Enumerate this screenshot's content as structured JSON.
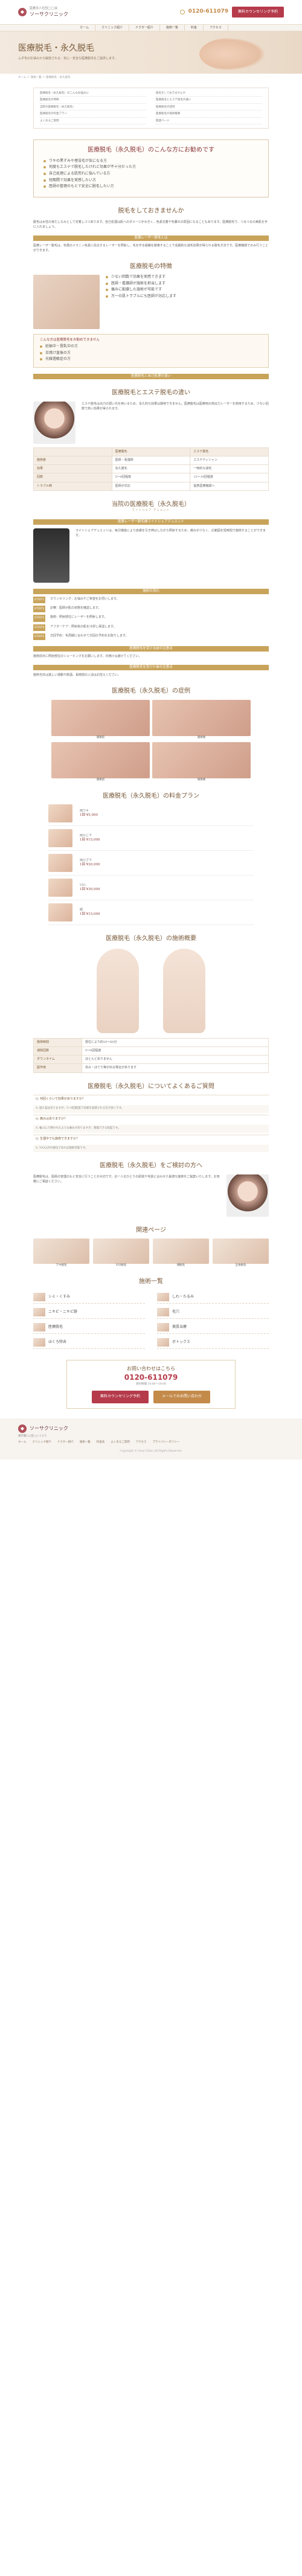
{
  "header": {
    "logo_sub": "医療法人社団◯◯会",
    "logo_name": "ソーサクリニック",
    "tel": "0120-611079",
    "reserve_label": "無料カウンセリング予約",
    "nav": [
      "ホーム",
      "クリニック紹介",
      "ドクター紹介",
      "施術一覧",
      "料金",
      "アクセス"
    ]
  },
  "hero": {
    "title": "医療脱毛・永久脱毛",
    "subtitle": "ムダ毛のお悩みから解放される、安心・安全な医療脱毛をご提供します。"
  },
  "breadcrumb": "ホーム ＞ 施術一覧 ＞ 医療脱毛・永久脱毛",
  "toc": [
    "医療脱毛（永久脱毛）のこんなお悩みに",
    "脱毛をしておきませんか",
    "医療脱毛の特徴",
    "医療脱毛とエステ脱毛の違い",
    "当院の医療脱毛（永久脱毛）",
    "医療脱毛の症例",
    "医療脱毛の料金プラン",
    "医療脱毛の施術概要",
    "よくあるご質問",
    "関連ページ"
  ],
  "lead": {
    "title": "医療脱毛（永久脱毛）のこんな方にお勧めです",
    "items": [
      "ワキの黒ずみや埋没毛が気になる方",
      "何度もエステで脱毛したけれど効果が不十分だった方",
      "自己処理による肌荒れに悩んでいる方",
      "短期間で効果を実感したい方",
      "医師の管理のもとで安全に脱毛したい方"
    ]
  },
  "intro": {
    "title": "脱毛をしておきませんか",
    "text": "脱毛は女性の身だしなみとして定着しつつあります。自己処理は肌へのダメージが大きく、色素沈着や毛嚢炎の原因になることもあります。医療脱毛で、つるつるの美肌を手に入れましょう。",
    "band": "医療レーザー脱毛とは",
    "band_text": "医療レーザー脱毛は、毛根のメラニン色素に反応するレーザーを照射し、毛を作る組織を破壊することで長期的な減毛効果が得られる脱毛方法です。医療機関でのみ行うことができます。"
  },
  "feature": {
    "title": "医療脱毛の特徴",
    "points": [
      "少ない回数で効果を実感できます",
      "医師・看護師が施術を担当します",
      "痛みに配慮した施術が可能です",
      "万一の肌トラブルにも医師が対応します"
    ],
    "note_title": "こんな方は医療脱毛をお勧めできません",
    "note_items": [
      "妊娠中・授乳中の方",
      "日焼け直後の方",
      "光線過敏症の方"
    ],
    "compare_band": "医療脱毛と自己処理の違い"
  },
  "compare": {
    "title": "医療脱毛とエステ脱毛の違い",
    "text": "エステ脱毛は出力の弱い光を用いるため、永久的な効果は期待できません。医療脱毛は医療用の高出力レーザーを使用するため、少ない回数で高い効果が得られます。",
    "table": [
      [
        "",
        "医療脱毛",
        "エステ脱毛"
      ],
      [
        "施術者",
        "医師・看護師",
        "エステティシャン"
      ],
      [
        "効果",
        "永久脱毛",
        "一時的な減毛"
      ],
      [
        "回数",
        "5〜8回程度",
        "12〜18回程度"
      ],
      [
        "トラブル時",
        "医師が対応",
        "提携医療機関へ"
      ]
    ]
  },
  "machine": {
    "title": "当院の医療脱毛（永久脱毛）",
    "subtitle": "ライトシェア デュエット",
    "band": "医療レーザー脱毛機ライトシェアデュエット",
    "text": "ライトシェアデュエットは、吸引機能により皮膚を引き伸ばしながら照射するため、痛みが少なく、広範囲を短時間で施術することができます。",
    "flow_band": "施術の流れ",
    "flow": [
      {
        "step": "STEP1",
        "text": "カウンセリング：お悩みやご希望をお伺いします。"
      },
      {
        "step": "STEP2",
        "text": "診察：医師が肌の状態を確認します。"
      },
      {
        "step": "STEP3",
        "text": "施術：照射部位にレーザーを照射します。"
      },
      {
        "step": "STEP4",
        "text": "アフターケア：照射後の肌を冷却し保湿します。"
      },
      {
        "step": "STEP5",
        "text": "次回予約：毛周期に合わせて次回の予約をお取りします。"
      }
    ],
    "merit_band": "医療脱毛を受ける前の注意点",
    "merit_text": "施術前日に照射部位のシェービングをお願いします。日焼けは避けてください。",
    "after_band": "医療脱毛を受けた後の注意点",
    "after_text": "施術当日は激しい運動や飲酒、長時間の入浴はお控えください。"
  },
  "cases": {
    "title": "医療脱毛（永久脱毛）の症例",
    "captions": [
      "施術前",
      "施術後",
      "施術前",
      "施術後"
    ]
  },
  "plans": {
    "title": "医療脱毛（永久脱毛）の料金プラン",
    "items": [
      {
        "name": "両ワキ",
        "price": "1回 ¥5,000"
      },
      {
        "name": "両ひじ下",
        "price": "1回 ¥15,000"
      },
      {
        "name": "両ひざ下",
        "price": "1回 ¥20,000"
      },
      {
        "name": "VIO",
        "price": "1回 ¥30,000"
      },
      {
        "name": "顔",
        "price": "1回 ¥15,000"
      }
    ]
  },
  "overview": {
    "title": "医療脱毛（永久脱毛）の施術概要",
    "rows": [
      [
        "施術時間",
        "部位により約10〜60分"
      ],
      [
        "通院回数",
        "5〜8回程度"
      ],
      [
        "ダウンタイム",
        "ほとんどありません"
      ],
      [
        "副作用",
        "赤み・ほてり等が出る場合があります"
      ]
    ]
  },
  "faq": {
    "title": "医療脱毛（永久脱毛）についてよくあるご質問",
    "items": [
      {
        "q": "Q. 何回くらいで効果がありますか？",
        "a": "A. 個人差はありますが、5〜8回程度で効果を実感される方が多いです。"
      },
      {
        "q": "Q. 痛みはありますか？",
        "a": "A. 輪ゴムで弾かれたような痛みがありますが、我慢できる程度です。"
      },
      {
        "q": "Q. 生理中でも施術できますか？",
        "a": "A. VIO以外の部位であれば施術可能です。"
      }
    ]
  },
  "doctor": {
    "title": "医療脱毛（永久脱毛）をご検討の方へ",
    "text": "医療脱毛は、医師の管理のもと安全に行うことが大切です。お一人おひとりの肌質や毛質に合わせた最適な施術をご提案いたします。お気軽にご相談ください。"
  },
  "related": {
    "title": "関連ページ",
    "items": [
      "ワキ脱毛",
      "VIO脱毛",
      "顔脱毛",
      "全身脱毛"
    ]
  },
  "treatments": {
    "title": "施術一覧",
    "items": [
      "シミ・くすみ",
      "しわ・たるみ",
      "ニキビ・ニキビ跡",
      "毛穴",
      "医療脱毛",
      "美肌治療",
      "ほくろ除去",
      "ボトックス"
    ]
  },
  "contact": {
    "title": "お問い合わせはこちら",
    "tel": "0120-611079",
    "hours": "受付時間 10:00〜19:00",
    "btn1": "無料カウンセリング予約",
    "btn2": "メールでのお問い合わせ"
  },
  "footer": {
    "logo_name": "ソーサクリニック",
    "address": "東京都○○区○○ 1-2-3",
    "nav": [
      "ホーム",
      "クリニック紹介",
      "ドクター紹介",
      "施術一覧",
      "料金表",
      "よくあるご質問",
      "アクセス",
      "プライバシーポリシー"
    ],
    "copyright": "Copyright © Sosa Clinic All Rights Reserved."
  },
  "colors": {
    "accent": "#c8a35a",
    "brand": "#b53a4a"
  }
}
